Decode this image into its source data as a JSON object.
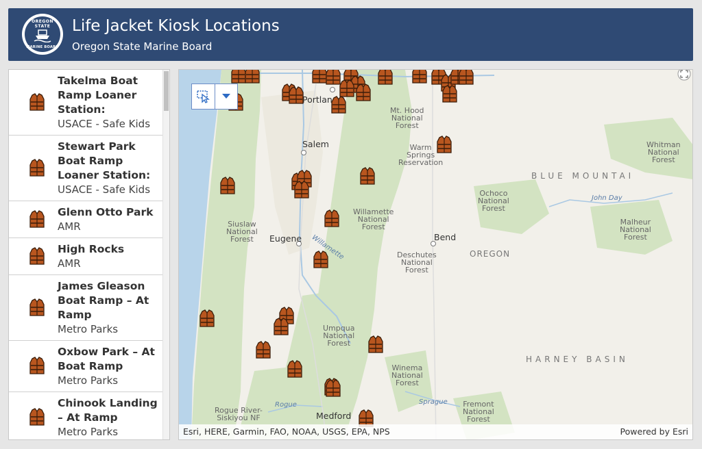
{
  "header": {
    "title": "Life Jacket Kiosk Locations",
    "subtitle": "Oregon State Marine Board",
    "logo": {
      "top_text": "OREGON STATE",
      "bottom_text": "MARINE BOARD"
    }
  },
  "list": {
    "items": [
      {
        "name": "Takelma Boat Ramp Loaner Station:",
        "org": "USACE - Safe Kids"
      },
      {
        "name": "Stewart Park Boat Ramp  Loaner Station:",
        "org": "USACE - Safe Kids"
      },
      {
        "name": "Glenn Otto Park",
        "org": "AMR"
      },
      {
        "name": "High Rocks",
        "org": "AMR"
      },
      {
        "name": "James Gleason Boat Ramp – At Ramp",
        "org": "Metro Parks"
      },
      {
        "name": "Oxbow Park – At Boat Ramp",
        "org": "Metro Parks"
      },
      {
        "name": "Chinook Landing – At Ramp",
        "org": "Metro Parks"
      }
    ]
  },
  "map": {
    "cities": {
      "portland": "Portland",
      "salem": "Salem",
      "eugene": "Eugene",
      "bend": "Bend",
      "medford": "Medford"
    },
    "features": {
      "mt_hood": [
        "Mt. Hood",
        "National",
        "Forest"
      ],
      "warm_springs": [
        "Warm",
        "Springs",
        "Reservation"
      ],
      "whitman": [
        "Whitman",
        "National",
        "Forest"
      ],
      "ochoco": [
        "Ochoco",
        "National",
        "Forest"
      ],
      "willamette_nf": [
        "Willamette",
        "National",
        "Forest"
      ],
      "siuslaw": [
        "Siuslaw",
        "National",
        "Forest"
      ],
      "malheur": [
        "Malheur",
        "National",
        "Forest"
      ],
      "deschutes": [
        "Deschutes",
        "National",
        "Forest"
      ],
      "umpqua": [
        "Umpqua",
        "National",
        "Forest"
      ],
      "winema": [
        "Winema",
        "National",
        "Forest"
      ],
      "fremont": [
        "Fremont",
        "National",
        "Forest"
      ],
      "rogue": [
        "Rogue River-",
        "Siskiyou NF"
      ]
    },
    "regions": {
      "blue_mountains": "BLUE MOUNTAI",
      "oregon": "OREGON",
      "harney": "HARNEY BASIN"
    },
    "water": {
      "willamette": "Willamette",
      "john_day": "John Day",
      "rogue": "Rogue",
      "sprague": "Sprague"
    },
    "attribution": "Esri, HERE, Garmin, FAO, NOAA, USGS, EPA, NPS",
    "powered_by": "Powered by Esri",
    "icons": {
      "kiosk": "life-jacket-icon",
      "select": "select-tool-icon",
      "dropdown": "caret-down-icon",
      "expand": "expand-icon"
    },
    "colors": {
      "header": "#2f4a74",
      "life_jacket": "#b8561f",
      "forest": "#d3e3c2",
      "water": "#b8d4ea"
    }
  }
}
